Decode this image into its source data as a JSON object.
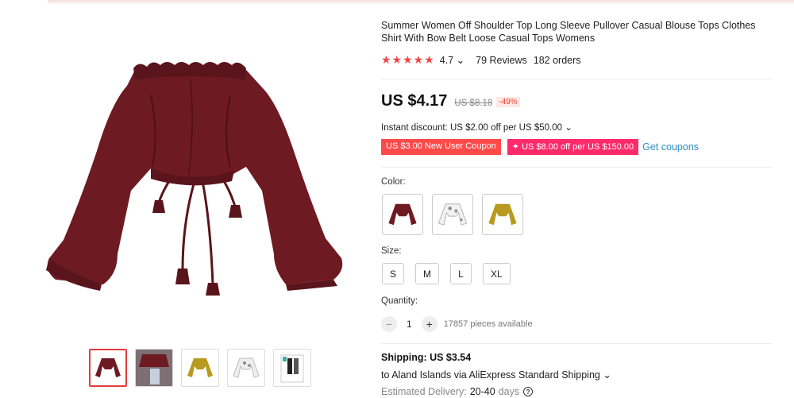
{
  "product": {
    "title": "Summer Women Off Shoulder Top Long Sleeve Pullover Casual Blouse Tops Clothes Shirt With Bow Belt Loose Casual Tops Womens",
    "rating": "4.7",
    "rating_chevron": "⌄",
    "reviews": "79 Reviews",
    "orders": "182 orders",
    "stars": "★★★★★"
  },
  "price": {
    "current": "US $4.17",
    "original": "US $8.18",
    "discount": "-49%"
  },
  "promo": {
    "instant_discount": "Instant discount: US $2.00 off per US $50.00 ⌄",
    "coupon_new_user": "US $3.00 New User Coupon",
    "coupon_store": "✦ US $8.00 off per US $150.00",
    "get_coupons": "Get coupons"
  },
  "options": {
    "color_label": "Color:",
    "colors": [
      "wine-red",
      "white-floral",
      "mustard-yellow"
    ],
    "size_label": "Size:",
    "sizes": [
      "S",
      "M",
      "L",
      "XL"
    ],
    "quantity_label": "Quantity:",
    "quantity": "1",
    "minus": "−",
    "plus": "+",
    "available": "17857 pieces available"
  },
  "shipping": {
    "cost": "Shipping: US $3.54",
    "to": "to Aland Islands via AliExpress Standard Shipping ⌄",
    "estimated_label": "Estimated Delivery:",
    "estimated_value": "20-40",
    "estimated_unit": "days",
    "help": "?"
  },
  "colors": {
    "wine": "#6e1a22",
    "accent_red": "#ff4a4a",
    "accent_pink": "#ff2a6a",
    "link_blue": "#2c8ec7",
    "mustard": "#b89a1e"
  },
  "icons": [
    "chevron-down-icon",
    "star-icon",
    "question-circle-icon",
    "plus-icon",
    "minus-icon"
  ]
}
